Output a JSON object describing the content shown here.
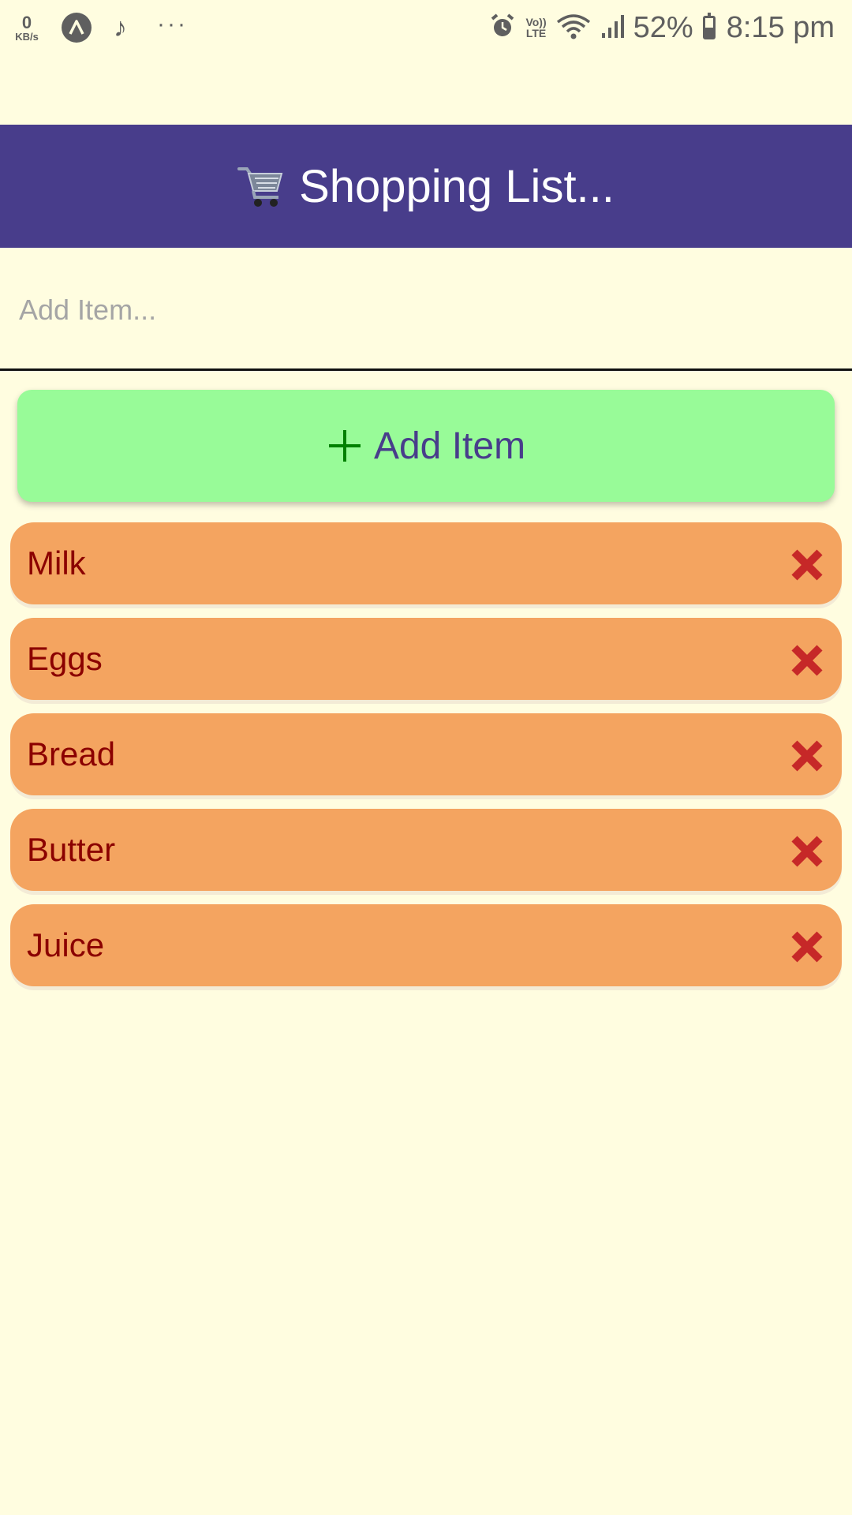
{
  "colors": {
    "background": "#FFFDE0",
    "header_bg": "#483D8B",
    "header_text": "#FFFFFF",
    "add_button_bg": "#98FB98",
    "add_button_text": "#483D8B",
    "plus_icon": "#008000",
    "list_item_bg": "#F4A460",
    "list_item_text": "#8B0000",
    "delete_icon": "#C62828",
    "status_text": "#5F5F5F"
  },
  "status_bar": {
    "net_speed_value": "0",
    "net_speed_unit": "KB/s",
    "volte_top": "Vo))",
    "volte_bottom": "LTE",
    "battery_percent": "52%",
    "battery_level": 0.52,
    "time": "8:15 pm",
    "icons": [
      "data-speed-icon",
      "a-circle-icon",
      "music-note-icon",
      "more-dots-icon",
      "alarm-icon",
      "volte-icon",
      "wifi-icon",
      "signal-icon",
      "battery-icon"
    ]
  },
  "header": {
    "icon": "shopping-cart-icon",
    "title": "Shopping List..."
  },
  "input": {
    "placeholder": "Add Item...",
    "value": ""
  },
  "add_button": {
    "icon": "plus-icon",
    "label": "Add Item"
  },
  "items": [
    {
      "label": "Milk",
      "icon": "close-icon"
    },
    {
      "label": "Eggs",
      "icon": "close-icon"
    },
    {
      "label": "Bread",
      "icon": "close-icon"
    },
    {
      "label": "Butter",
      "icon": "close-icon"
    },
    {
      "label": "Juice",
      "icon": "close-icon"
    }
  ]
}
